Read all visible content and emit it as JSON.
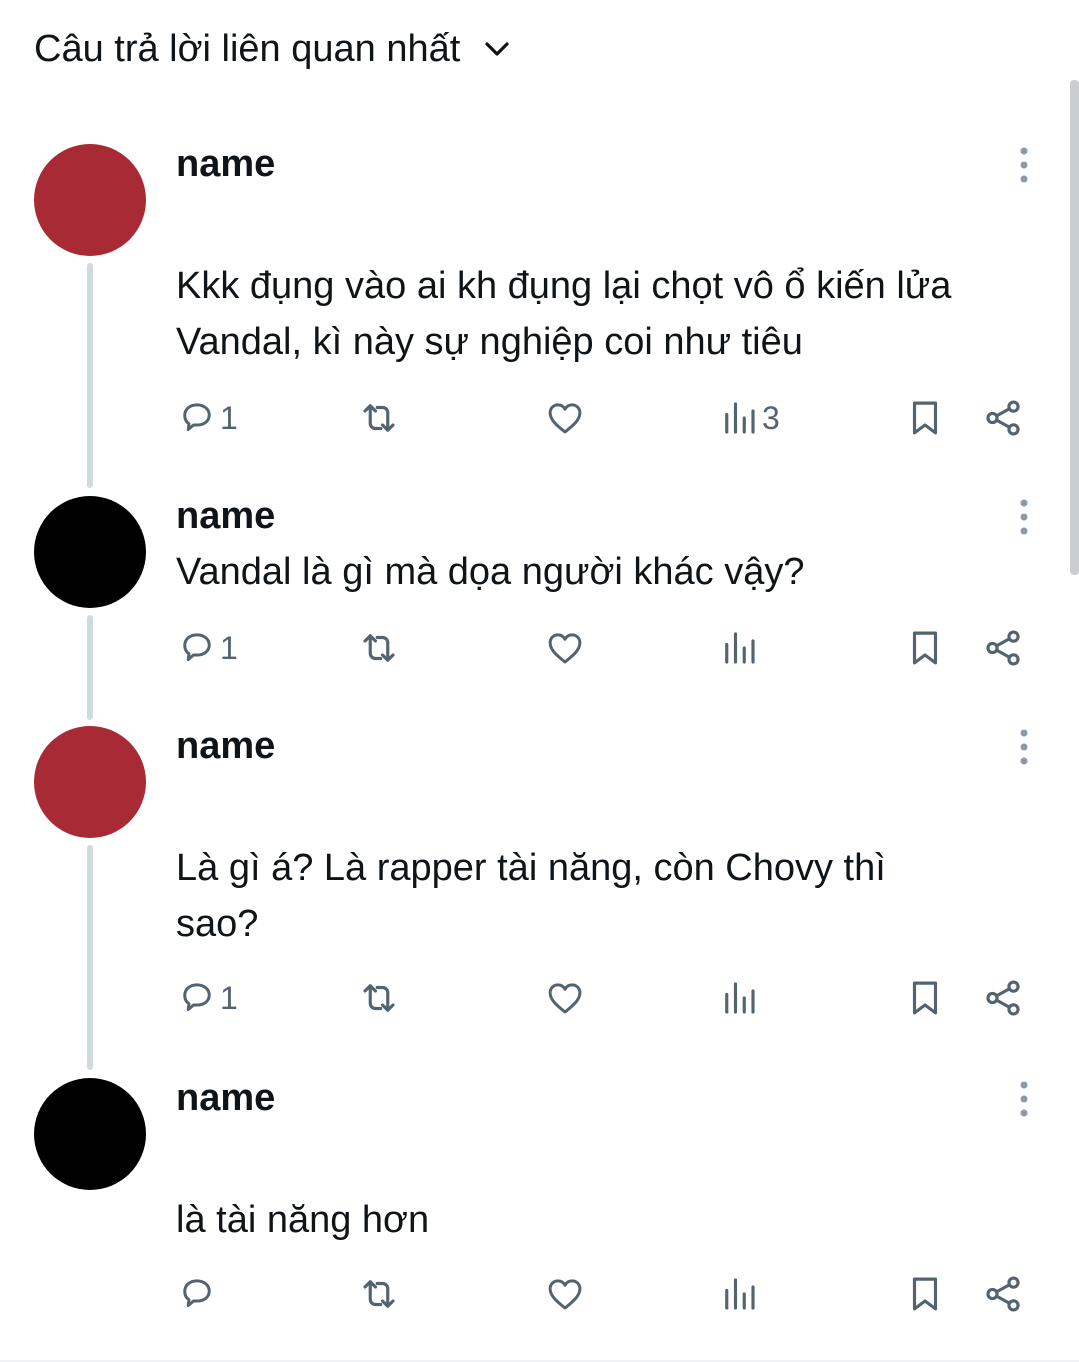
{
  "header": {
    "title": "Câu trả lời liên quan nhất",
    "dropdown_icon": "chevron-down-icon"
  },
  "colors": {
    "avatar_red": "#a82a35",
    "avatar_black": "#000000",
    "icon_gray": "#536471",
    "thread_line": "#cfd9de"
  },
  "replies": [
    {
      "name": "name",
      "text": "Kkk đụng vào ai kh đụng lại chọt vô ổ kiến lửa\nVandal, kì này sự nghiệp coi như tiêu",
      "replies_count": "1",
      "views_count": "3"
    },
    {
      "name": "name",
      "text": "Vandal là gì mà dọa người khác vậy?",
      "replies_count": "1",
      "views_count": ""
    },
    {
      "name": "name",
      "text": "Là gì á? Là rapper tài năng, còn Chovy thì\nsao?",
      "replies_count": "1",
      "views_count": ""
    },
    {
      "name": "name",
      "text": "là tài năng hơn",
      "replies_count": "",
      "views_count": ""
    }
  ]
}
